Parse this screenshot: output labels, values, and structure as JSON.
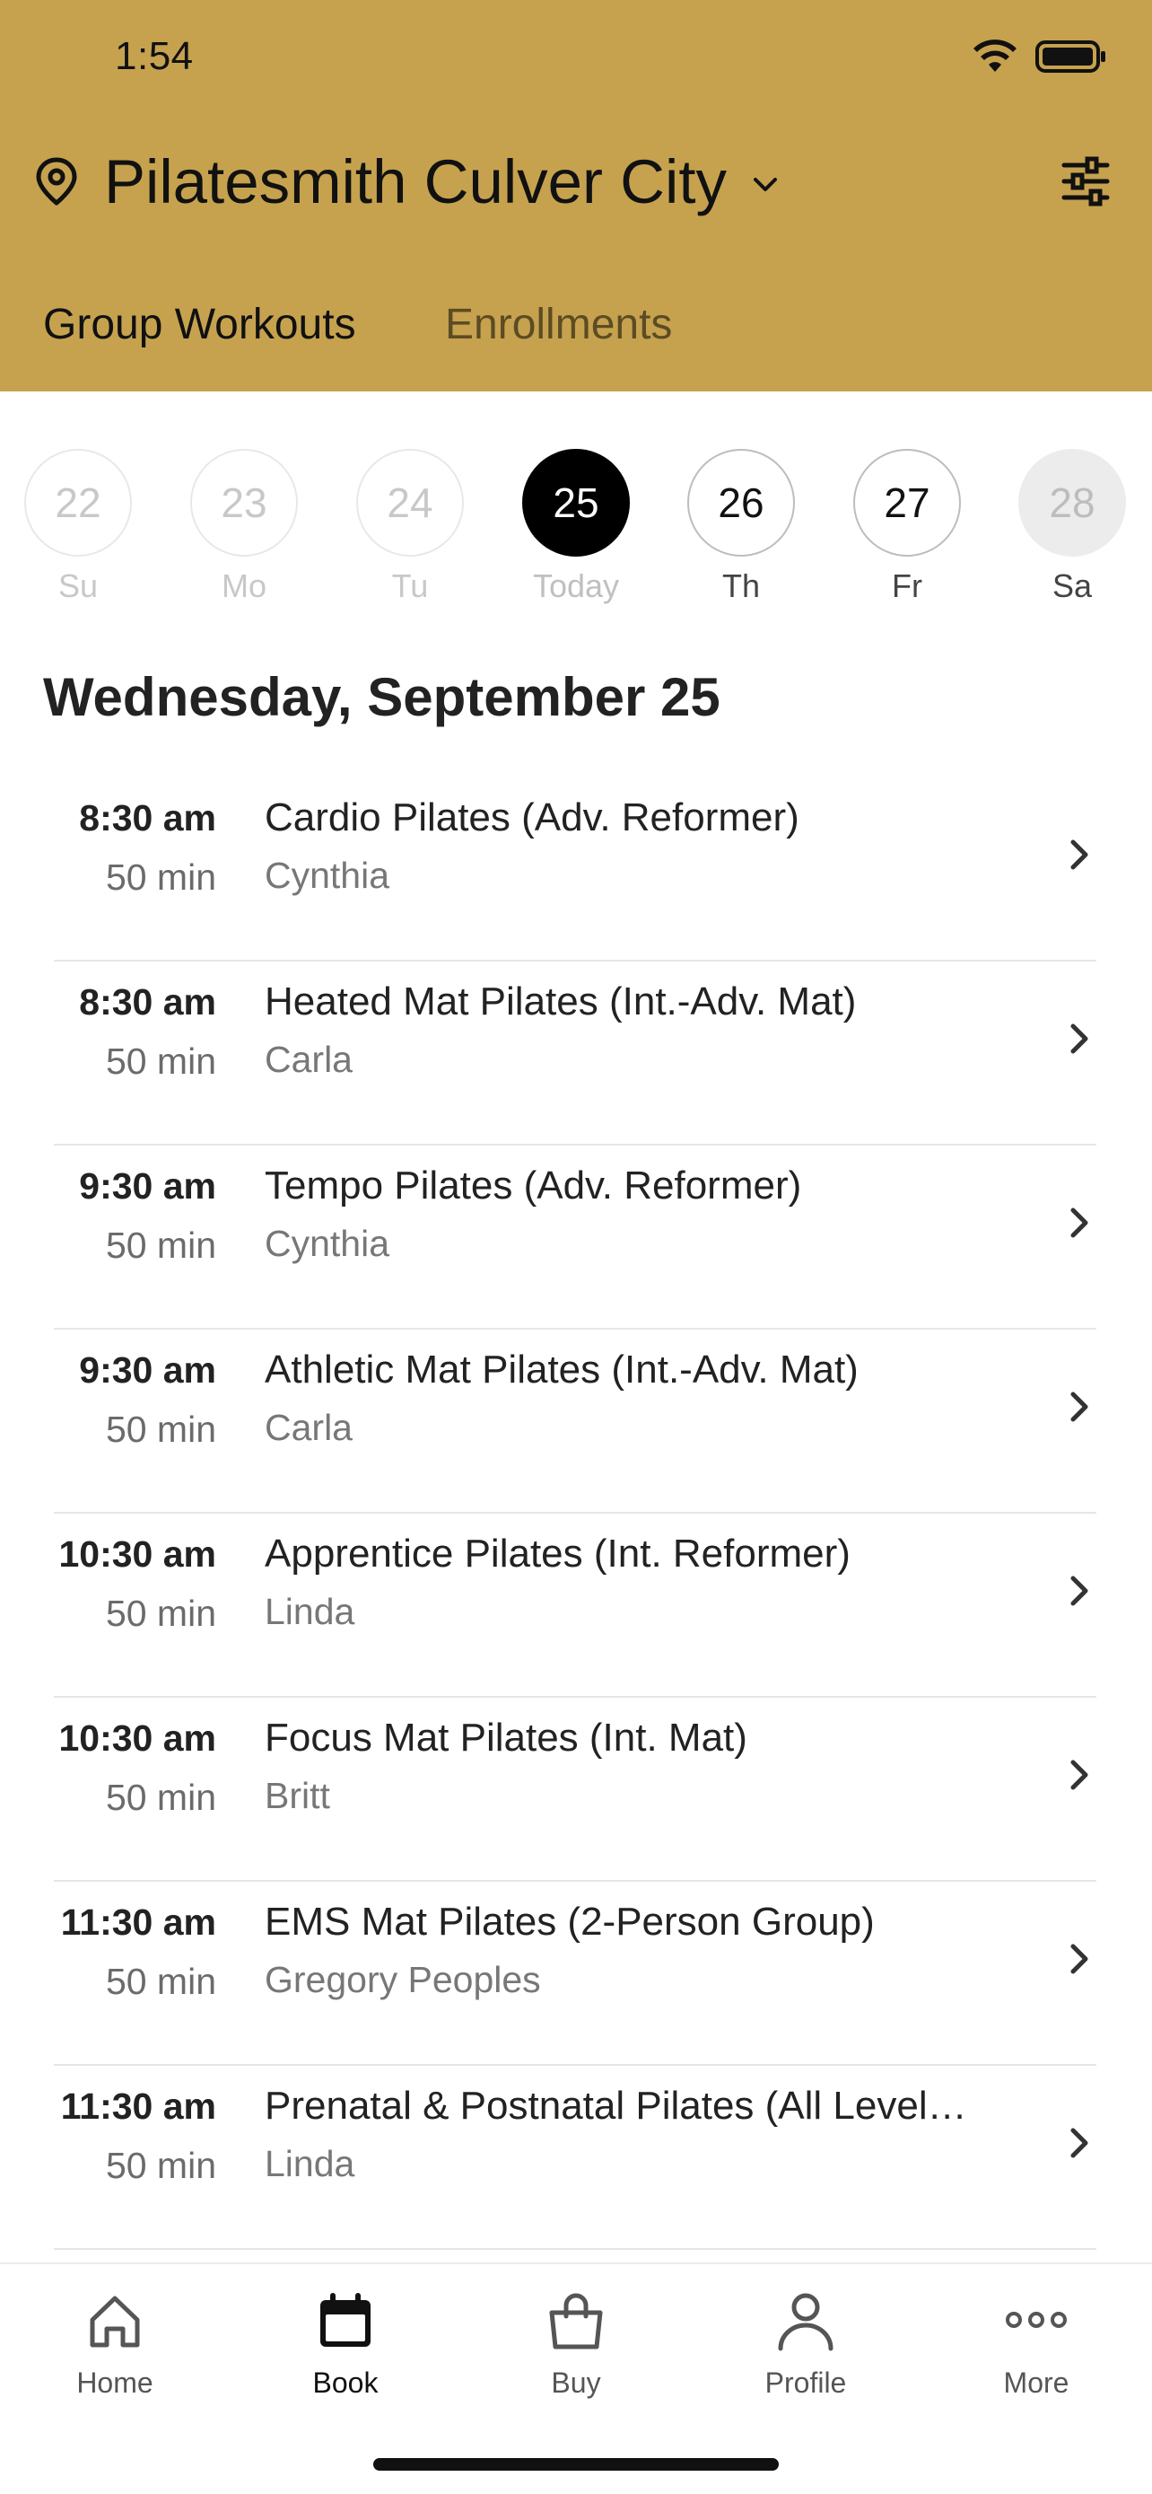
{
  "status_bar": {
    "time": "1:54"
  },
  "header": {
    "location": "Pilatesmith Culver City",
    "tabs": [
      {
        "label": "Group Workouts",
        "active": true
      },
      {
        "label": "Enrollments",
        "active": false
      }
    ],
    "accent_color": "#C6A24F"
  },
  "date_strip": {
    "days": [
      {
        "number": "22",
        "label": "Su",
        "state": "past"
      },
      {
        "number": "23",
        "label": "Mo",
        "state": "past"
      },
      {
        "number": "24",
        "label": "Tu",
        "state": "past"
      },
      {
        "number": "25",
        "label": "Today",
        "state": "selected"
      },
      {
        "number": "26",
        "label": "Th",
        "state": "future"
      },
      {
        "number": "27",
        "label": "Fr",
        "state": "future"
      },
      {
        "number": "28",
        "label": "Sa",
        "state": "unavailable"
      }
    ]
  },
  "schedule": {
    "heading": "Wednesday, September 25",
    "classes": [
      {
        "time": "8:30 am",
        "duration": "50 min",
        "name": "Cardio Pilates (Adv. Reformer)",
        "instructor": "Cynthia"
      },
      {
        "time": "8:30 am",
        "duration": "50 min",
        "name": "Heated Mat Pilates (Int.-Adv. Mat)",
        "instructor": "Carla"
      },
      {
        "time": "9:30 am",
        "duration": "50 min",
        "name": "Tempo Pilates (Adv. Reformer)",
        "instructor": "Cynthia"
      },
      {
        "time": "9:30 am",
        "duration": "50 min",
        "name": "Athletic Mat Pilates (Int.-Adv. Mat)",
        "instructor": "Carla"
      },
      {
        "time": "10:30 am",
        "duration": "50 min",
        "name": "Apprentice Pilates (Int. Reformer)",
        "instructor": "Linda"
      },
      {
        "time": "10:30 am",
        "duration": "50 min",
        "name": "Focus Mat Pilates (Int. Mat)",
        "instructor": "Britt"
      },
      {
        "time": "11:30 am",
        "duration": "50 min",
        "name": "EMS Mat Pilates (2-Person Group)",
        "instructor": "Gregory Peoples"
      },
      {
        "time": "11:30 am",
        "duration": "50 min",
        "name": "Prenatal & Postnatal Pilates (All Level…",
        "instructor": "Linda"
      }
    ]
  },
  "bottom_nav": {
    "items": [
      {
        "label": "Home",
        "icon": "home-icon",
        "active": false
      },
      {
        "label": "Book",
        "icon": "calendar-icon",
        "active": true
      },
      {
        "label": "Buy",
        "icon": "shopping-bag-icon",
        "active": false
      },
      {
        "label": "Profile",
        "icon": "person-icon",
        "active": false
      },
      {
        "label": "More",
        "icon": "more-dots-icon",
        "active": false
      }
    ]
  }
}
